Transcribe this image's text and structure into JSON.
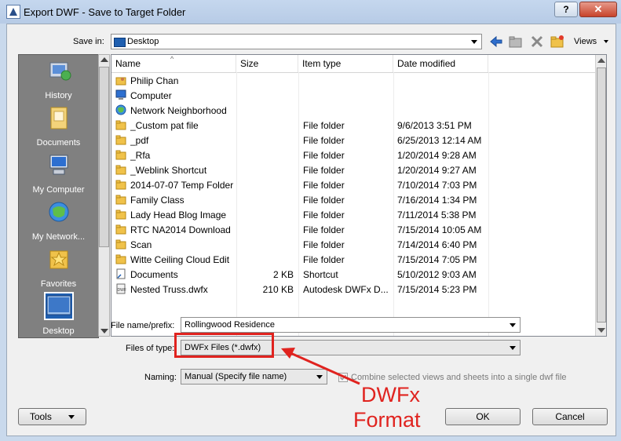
{
  "window": {
    "title": "Export DWF - Save to Target Folder",
    "help_label": "?",
    "close_label": "✕"
  },
  "save_in": {
    "label": "Save in:",
    "value": "Desktop"
  },
  "toolbar": {
    "views_label": "Views"
  },
  "places": [
    {
      "label": "History",
      "icon": "history-icon"
    },
    {
      "label": "Documents",
      "icon": "documents-icon"
    },
    {
      "label": "My Computer",
      "icon": "computer-icon"
    },
    {
      "label": "My Network...",
      "icon": "network-icon"
    },
    {
      "label": "Favorites",
      "icon": "favorites-icon"
    },
    {
      "label": "Desktop",
      "icon": "desktop-icon"
    }
  ],
  "columns": [
    "Name",
    "Size",
    "Item type",
    "Date modified"
  ],
  "files": [
    {
      "name": "Philip Chan",
      "size": "",
      "type": "",
      "date": "",
      "icon": "user-folder-icon"
    },
    {
      "name": "Computer",
      "size": "",
      "type": "",
      "date": "",
      "icon": "computer-icon"
    },
    {
      "name": "Network Neighborhood",
      "size": "",
      "type": "",
      "date": "",
      "icon": "network-icon"
    },
    {
      "name": "_Custom pat file",
      "size": "",
      "type": "File folder",
      "date": "9/6/2013 3:51 PM",
      "icon": "folder-icon"
    },
    {
      "name": "_pdf",
      "size": "",
      "type": "File folder",
      "date": "6/25/2013 12:14 AM",
      "icon": "folder-icon"
    },
    {
      "name": "_Rfa",
      "size": "",
      "type": "File folder",
      "date": "1/20/2014 9:28 AM",
      "icon": "folder-icon"
    },
    {
      "name": "_Weblink Shortcut",
      "size": "",
      "type": "File folder",
      "date": "1/20/2014 9:27 AM",
      "icon": "folder-icon"
    },
    {
      "name": "2014-07-07 Temp Folder",
      "size": "",
      "type": "File folder",
      "date": "7/10/2014 7:03 PM",
      "icon": "folder-icon"
    },
    {
      "name": "Family Class",
      "size": "",
      "type": "File folder",
      "date": "7/16/2014 1:34 PM",
      "icon": "folder-icon"
    },
    {
      "name": "Lady Head Blog Image",
      "size": "",
      "type": "File folder",
      "date": "7/11/2014 5:38 PM",
      "icon": "folder-icon"
    },
    {
      "name": "RTC NA2014 Download",
      "size": "",
      "type": "File folder",
      "date": "7/15/2014 10:05 AM",
      "icon": "folder-icon"
    },
    {
      "name": "Scan",
      "size": "",
      "type": "File folder",
      "date": "7/14/2014 6:40 PM",
      "icon": "folder-icon"
    },
    {
      "name": "Witte Ceiling Cloud Edit",
      "size": "",
      "type": "File folder",
      "date": "7/15/2014 7:05 PM",
      "icon": "folder-icon"
    },
    {
      "name": "Documents",
      "size": "2 KB",
      "type": "Shortcut",
      "date": "5/10/2012 9:03 AM",
      "icon": "shortcut-icon"
    },
    {
      "name": "Nested Truss.dwfx",
      "size": "210 KB",
      "type": "Autodesk DWFx D...",
      "date": "7/15/2014 5:23 PM",
      "icon": "dwfx-file-icon"
    }
  ],
  "filename": {
    "label": "File name/prefix:",
    "value": "Rollingwood Residence"
  },
  "filetype": {
    "label": "Files of type:",
    "value": "DWFx Files (*.dwfx)"
  },
  "naming": {
    "label": "Naming:",
    "value": "Manual (Specify file name)",
    "combine_label": "Combine selected views and sheets into a single dwf file",
    "combine_checked": true
  },
  "buttons": {
    "tools": "Tools",
    "ok": "OK",
    "cancel": "Cancel"
  },
  "annotation": {
    "line1": "DWFx",
    "line2": "Format",
    "color": "#e0231f"
  }
}
